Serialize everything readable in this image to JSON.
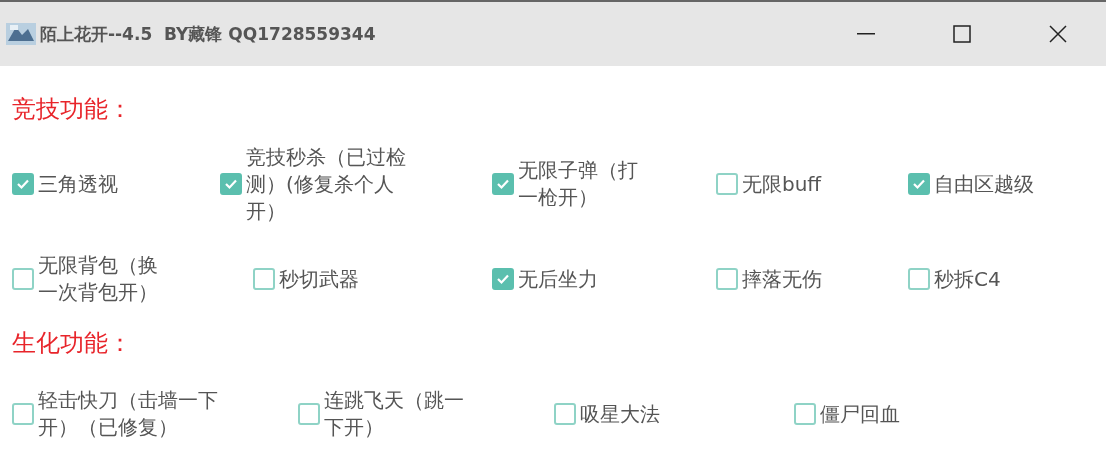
{
  "window": {
    "title": "陌上花开--4.5  BY藏锋 QQ1728559344"
  },
  "sections": [
    {
      "title": "竞技功能：",
      "rows": [
        [
          {
            "label": "三角透视",
            "checked": true
          },
          {
            "label": "竞技秒杀（已过检测）(修复杀个人开）",
            "checked": true
          },
          {
            "label": "无限子弹（打一枪开）",
            "checked": true
          },
          {
            "label": "无限buff",
            "checked": false
          },
          {
            "label": "自由区越级",
            "checked": true
          }
        ],
        [
          {
            "label": "无限背包（换一次背包开）",
            "checked": false
          },
          {
            "label": "秒切武器",
            "checked": false
          },
          {
            "label": "无后坐力",
            "checked": true
          },
          {
            "label": "摔落无伤",
            "checked": false
          },
          {
            "label": "秒拆C4",
            "checked": false
          }
        ]
      ]
    },
    {
      "title": "生化功能：",
      "rows": [
        [
          {
            "label": "轻击快刀（击墙一下开）（已修复）",
            "checked": false
          },
          {
            "label": "连跳飞天（跳一下开）",
            "checked": false
          },
          {
            "label": "吸星大法",
            "checked": false
          },
          {
            "label": "僵尸回血",
            "checked": false
          }
        ]
      ]
    }
  ]
}
